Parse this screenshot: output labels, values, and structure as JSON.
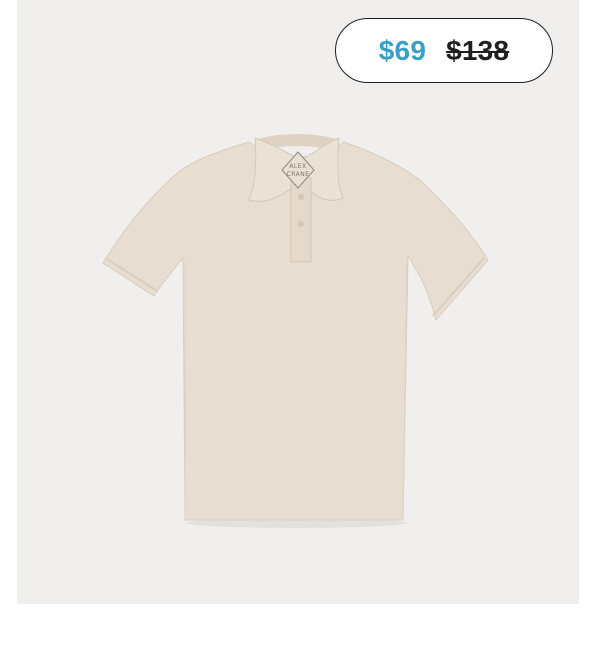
{
  "product": {
    "image_alt": "Beige short-sleeve polo shirt",
    "label_text_line1": "ALEX",
    "label_text_line2": "CRANE",
    "price": {
      "sale": "$69",
      "original": "$138"
    }
  },
  "colors": {
    "card_background": "#f0efee",
    "shirt": "#e7ddd0",
    "sale_price": "#3a9fc7",
    "original_price": "#1f1f1f"
  }
}
